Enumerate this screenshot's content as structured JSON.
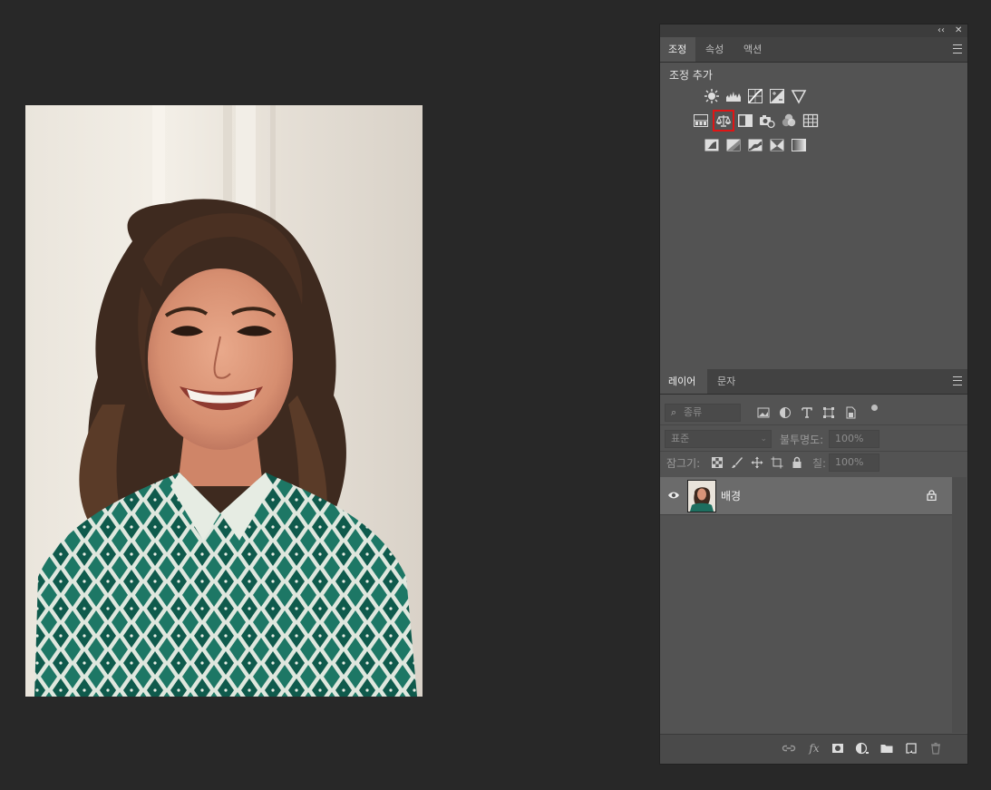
{
  "adjustments_panel": {
    "tabs": [
      {
        "label": "조정",
        "active": true
      },
      {
        "label": "속성",
        "active": false
      },
      {
        "label": "액션",
        "active": false
      }
    ],
    "title": "조정 추가",
    "icon_rows": [
      [
        "brightness-contrast-icon",
        "levels-icon",
        "curves-icon",
        "exposure-icon",
        "vibrance-icon"
      ],
      [
        "hue-saturation-icon",
        "color-balance-icon",
        "black-white-icon",
        "photo-filter-icon",
        "channel-mixer-icon",
        "color-lookup-icon"
      ],
      [
        "invert-icon",
        "posterize-icon",
        "threshold-icon",
        "selective-color-icon",
        "gradient-map-icon"
      ]
    ],
    "selected_icon": "color-balance-icon"
  },
  "layers_panel": {
    "tabs": [
      {
        "label": "레이어",
        "active": true
      },
      {
        "label": "문자",
        "active": false
      }
    ],
    "filter_placeholder": "종류",
    "blend_mode": "표준",
    "opacity_label": "불투명도:",
    "opacity_value": "100%",
    "lock_label": "잠그기:",
    "fill_label": "칠:",
    "fill_value": "100%",
    "layers": [
      {
        "name": "배경",
        "visible": true,
        "locked": true
      }
    ]
  },
  "dock_controls": {
    "collapse": "‹‹",
    "close": "✕"
  },
  "colors": {
    "app_background": "#282828",
    "panel": "#535353",
    "selection_highlight": "#e01515",
    "layer_row": "#6b6b6b"
  }
}
